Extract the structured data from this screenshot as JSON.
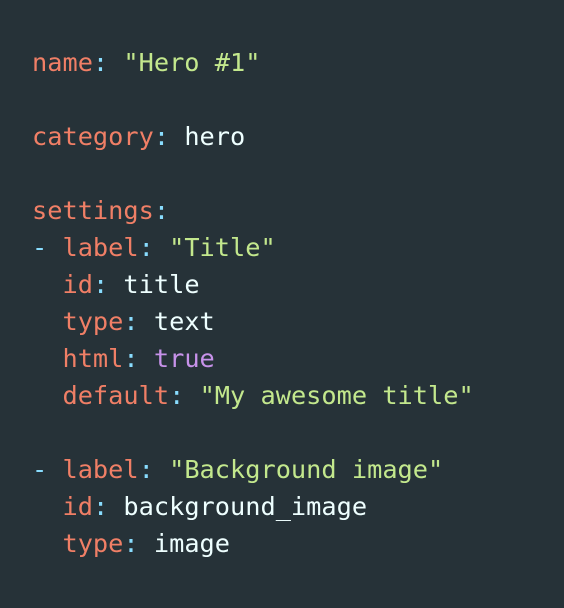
{
  "editor": {
    "line1": {
      "key": "name",
      "colon": ": ",
      "value": "\"Hero #1\""
    },
    "line2": {
      "key": "category",
      "colon": ": ",
      "value": "hero"
    },
    "line3": {
      "key": "settings",
      "colon": ":"
    },
    "line4": {
      "dash": "- ",
      "key": "label",
      "colon": ": ",
      "value": "\"Title\""
    },
    "line5": {
      "indent": "  ",
      "key": "id",
      "colon": ": ",
      "value": "title"
    },
    "line6": {
      "indent": "  ",
      "key": "type",
      "colon": ": ",
      "value": "text"
    },
    "line7": {
      "indent": "  ",
      "key": "html",
      "colon": ": ",
      "value": "true"
    },
    "line8": {
      "indent": "  ",
      "key": "default",
      "colon": ": ",
      "value": "\"My awesome title\""
    },
    "line9": {
      "dash": "- ",
      "key": "label",
      "colon": ": ",
      "value": "\"Background image\""
    },
    "line10": {
      "indent": "  ",
      "key": "id",
      "colon": ": ",
      "value": "background_image"
    },
    "line11": {
      "indent": "  ",
      "key": "type",
      "colon": ": ",
      "value": "image"
    }
  },
  "colors": {
    "background": "#263238",
    "key": "#f07f66",
    "punctuation": "#89ddff",
    "string": "#c3e88d",
    "plain": "#eeffff",
    "boolean": "#c792ea"
  }
}
